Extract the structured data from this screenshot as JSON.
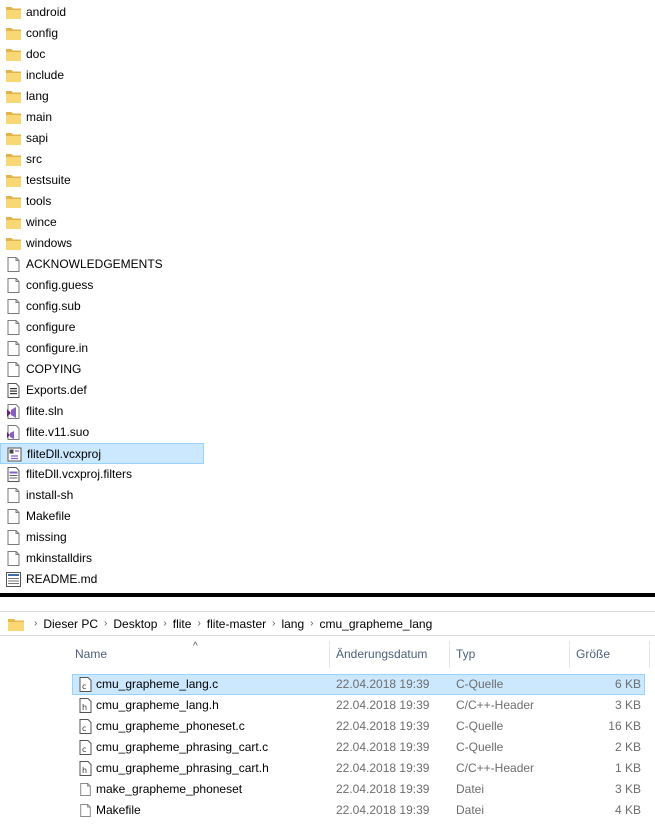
{
  "top_pane": {
    "items": [
      {
        "label": "android",
        "icon": "folder-icon"
      },
      {
        "label": "config",
        "icon": "folder-icon"
      },
      {
        "label": "doc",
        "icon": "folder-icon"
      },
      {
        "label": "include",
        "icon": "folder-icon"
      },
      {
        "label": "lang",
        "icon": "folder-icon"
      },
      {
        "label": "main",
        "icon": "folder-icon"
      },
      {
        "label": "sapi",
        "icon": "folder-icon"
      },
      {
        "label": "src",
        "icon": "folder-icon"
      },
      {
        "label": "testsuite",
        "icon": "folder-icon"
      },
      {
        "label": "tools",
        "icon": "folder-icon"
      },
      {
        "label": "wince",
        "icon": "folder-icon"
      },
      {
        "label": "windows",
        "icon": "folder-icon"
      },
      {
        "label": "ACKNOWLEDGEMENTS",
        "icon": "file-icon"
      },
      {
        "label": "config.guess",
        "icon": "file-icon"
      },
      {
        "label": "config.sub",
        "icon": "file-icon"
      },
      {
        "label": "configure",
        "icon": "file-icon"
      },
      {
        "label": "configure.in",
        "icon": "file-icon"
      },
      {
        "label": "COPYING",
        "icon": "file-icon"
      },
      {
        "label": "Exports.def",
        "icon": "def-file-icon"
      },
      {
        "label": "flite.sln",
        "icon": "visual-studio-solution-icon"
      },
      {
        "label": "flite.v11.suo",
        "icon": "visual-studio-suo-icon"
      },
      {
        "label": "fliteDll.vcxproj",
        "icon": "vcxproj-file-icon",
        "selected": true
      },
      {
        "label": "fliteDll.vcxproj.filters",
        "icon": "filters-file-icon"
      },
      {
        "label": "install-sh",
        "icon": "file-icon"
      },
      {
        "label": "Makefile",
        "icon": "file-icon"
      },
      {
        "label": "missing",
        "icon": "file-icon"
      },
      {
        "label": "mkinstalldirs",
        "icon": "file-icon"
      },
      {
        "label": "README.md",
        "icon": "markdown-file-icon"
      }
    ]
  },
  "bottom_pane": {
    "breadcrumb": [
      "Dieser PC",
      "Desktop",
      "flite",
      "flite-master",
      "lang",
      "cmu_grapheme_lang"
    ],
    "columns": {
      "name": "Name",
      "date": "Änderungsdatum",
      "type": "Typ",
      "size": "Größe"
    },
    "rows": [
      {
        "name": "cmu_grapheme_lang.c",
        "date": "22.04.2018 19:39",
        "type": "C-Quelle",
        "size": "6 KB",
        "icon": "c-source-file-icon",
        "selected": true
      },
      {
        "name": "cmu_grapheme_lang.h",
        "date": "22.04.2018 19:39",
        "type": "C/C++-Header",
        "size": "3 KB",
        "icon": "header-file-icon"
      },
      {
        "name": "cmu_grapheme_phoneset.c",
        "date": "22.04.2018 19:39",
        "type": "C-Quelle",
        "size": "16 KB",
        "icon": "c-source-file-icon"
      },
      {
        "name": "cmu_grapheme_phrasing_cart.c",
        "date": "22.04.2018 19:39",
        "type": "C-Quelle",
        "size": "2 KB",
        "icon": "c-source-file-icon"
      },
      {
        "name": "cmu_grapheme_phrasing_cart.h",
        "date": "22.04.2018 19:39",
        "type": "C/C++-Header",
        "size": "1 KB",
        "icon": "header-file-icon"
      },
      {
        "name": "make_grapheme_phoneset",
        "date": "22.04.2018 19:39",
        "type": "Datei",
        "size": "3 KB",
        "icon": "file-icon"
      },
      {
        "name": "Makefile",
        "date": "22.04.2018 19:39",
        "type": "Datei",
        "size": "4 KB",
        "icon": "file-icon"
      }
    ]
  },
  "colors": {
    "folder": "#f8d775",
    "selection": "#cce8ff",
    "selection_border": "#99d1ff",
    "header_text": "#4c607a"
  }
}
